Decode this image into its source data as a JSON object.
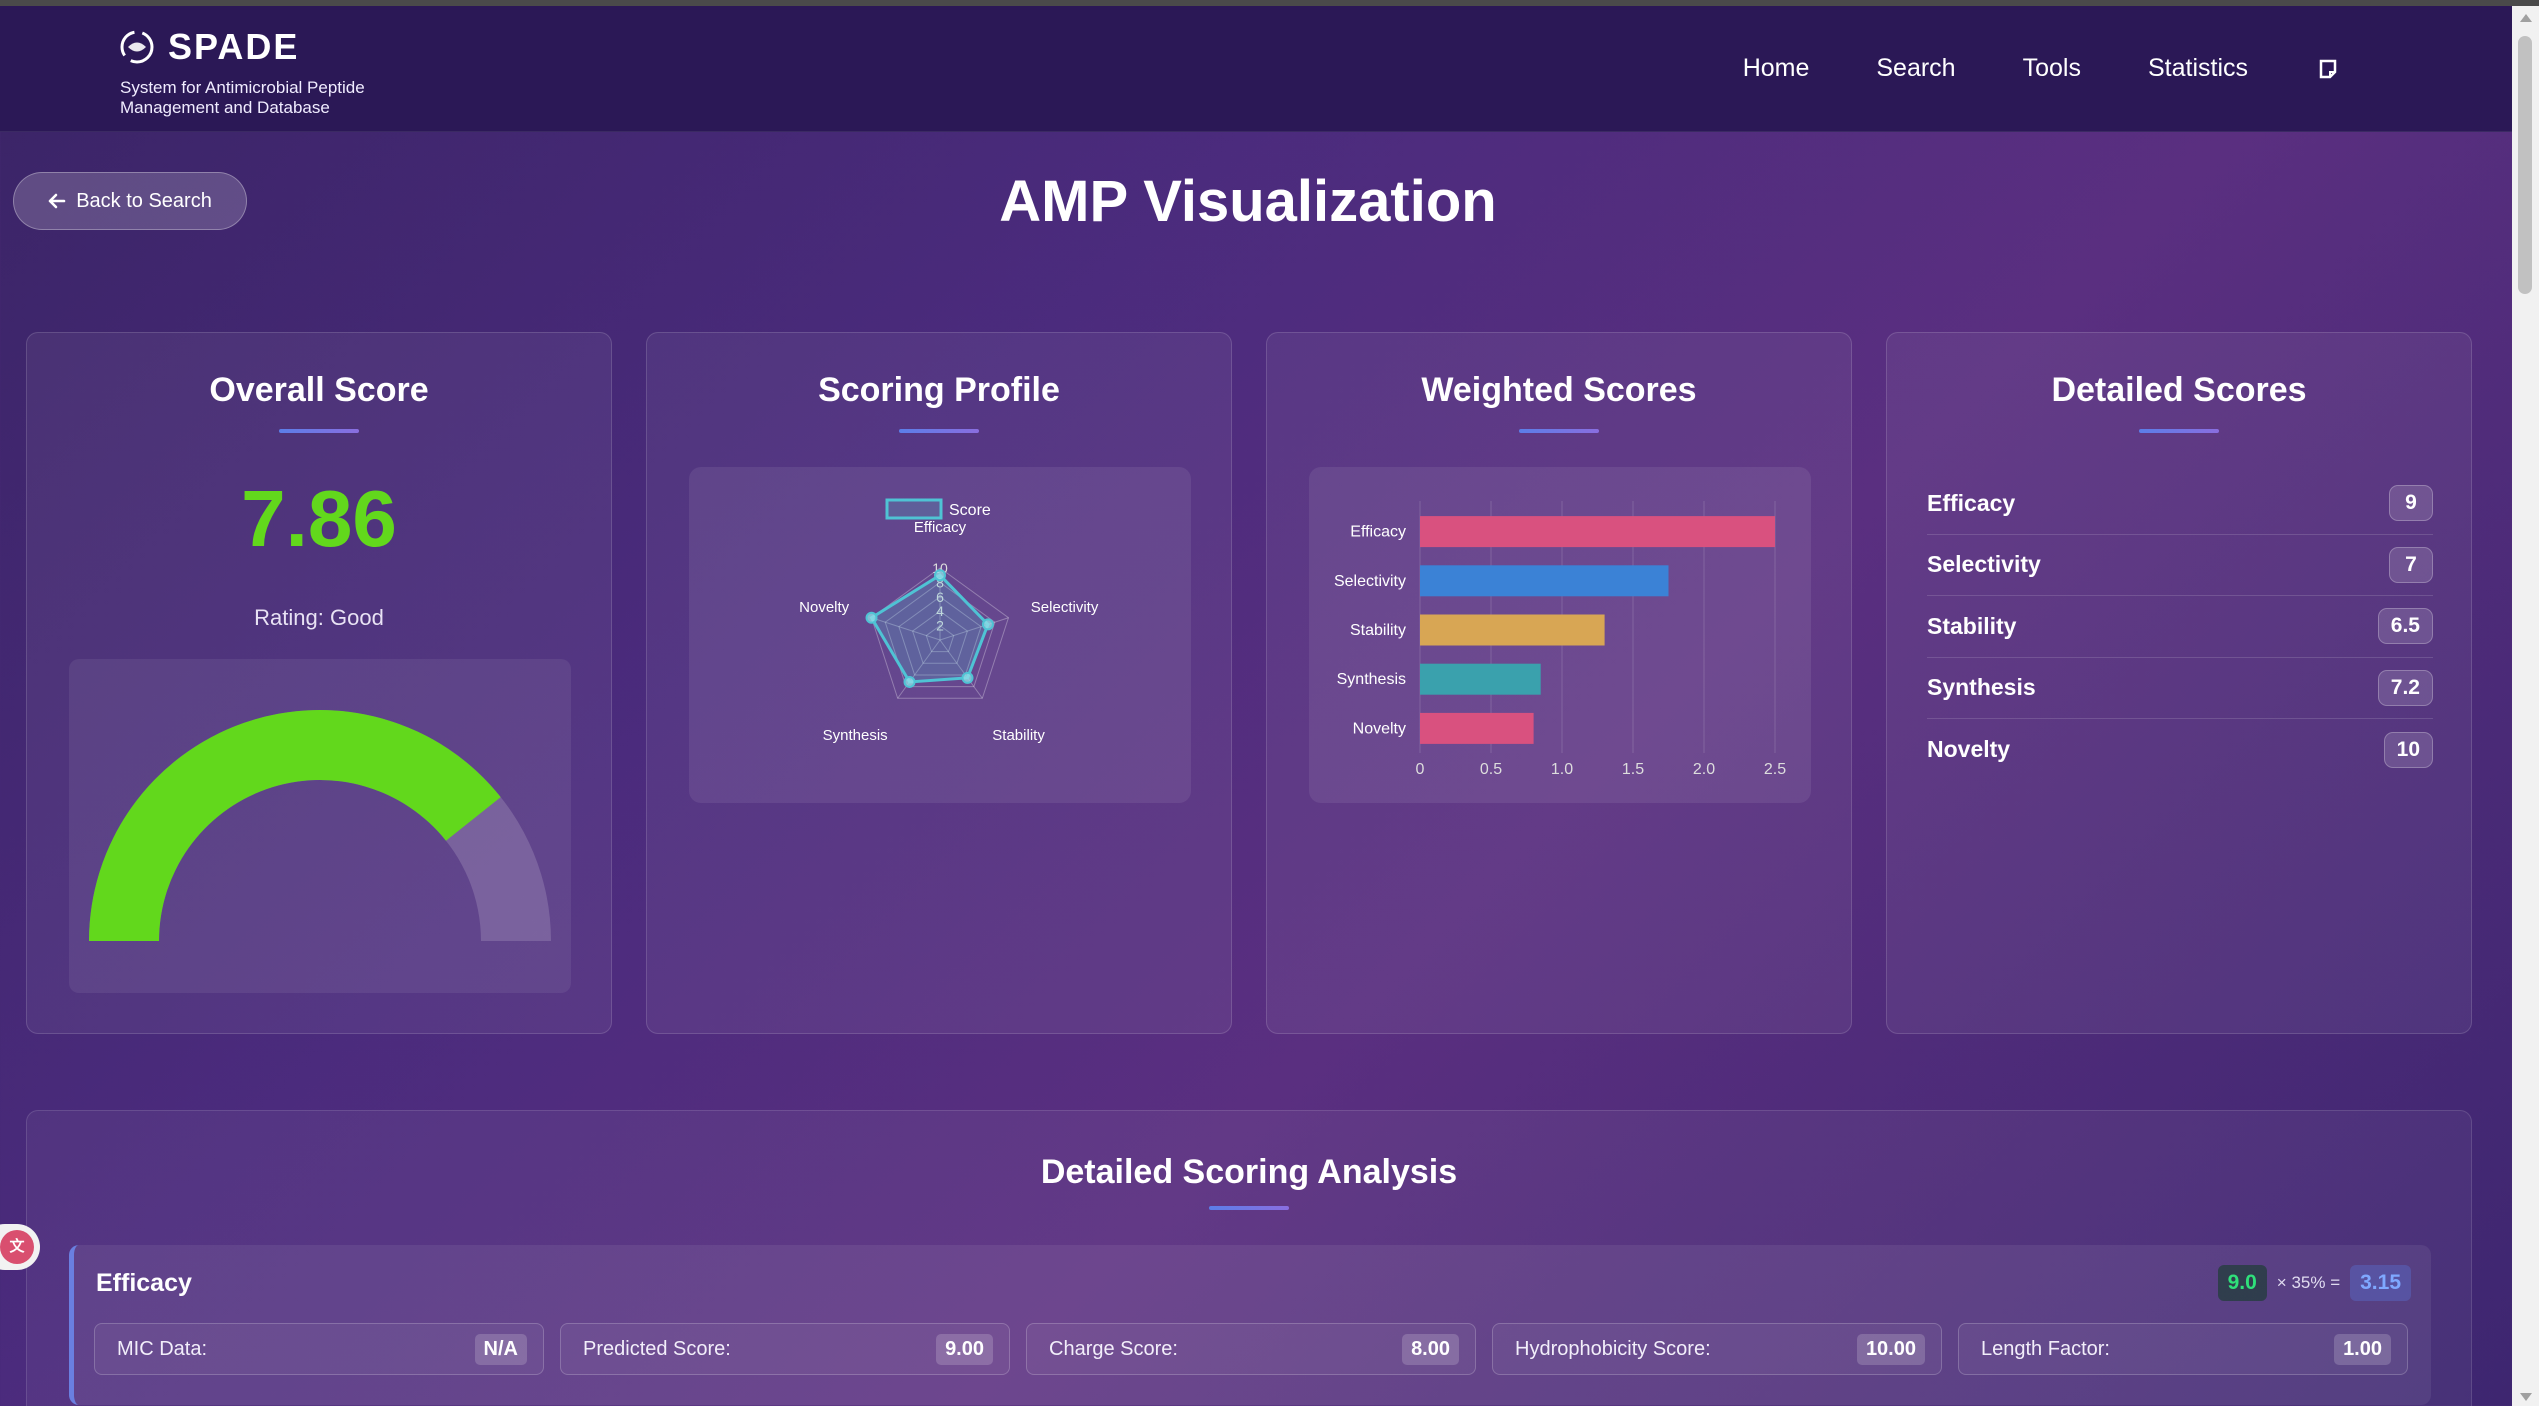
{
  "brand": {
    "title": "SPADE",
    "subtitle": "System for Antimicrobial Peptide Management and Database"
  },
  "nav": {
    "links": [
      "Home",
      "Search",
      "Tools",
      "Statistics"
    ],
    "extra_icon": "note-icon"
  },
  "back_button": "Back to Search",
  "page_title": "AMP Visualization",
  "overall": {
    "title": "Overall Score",
    "score": "7.86",
    "rating": "Rating: Good",
    "gauge_fraction": 0.786,
    "gauge_color": "#62d81c"
  },
  "profile": {
    "title": "Scoring Profile",
    "legend": "Score"
  },
  "weighted": {
    "title": "Weighted Scores"
  },
  "details": {
    "title": "Detailed Scores",
    "items": [
      {
        "label": "Efficacy",
        "value": "9"
      },
      {
        "label": "Selectivity",
        "value": "7"
      },
      {
        "label": "Stability",
        "value": "6.5"
      },
      {
        "label": "Synthesis",
        "value": "7.2"
      },
      {
        "label": "Novelty",
        "value": "10"
      }
    ]
  },
  "analysis": {
    "title": "Detailed Scoring Analysis",
    "criterion": {
      "name": "Efficacy",
      "raw": "9.0",
      "weight_text": "× 35% =",
      "weighted": "3.15",
      "metrics": [
        {
          "label": "MIC Data:",
          "value": "N/A"
        },
        {
          "label": "Predicted Score:",
          "value": "9.00"
        },
        {
          "label": "Charge Score:",
          "value": "8.00"
        },
        {
          "label": "Hydrophobicity Score:",
          "value": "10.00"
        },
        {
          "label": "Length Factor:",
          "value": "1.00"
        }
      ]
    }
  },
  "colors": {
    "accent_green": "#62d81c",
    "radar": "#4fc3d4",
    "bars": [
      "#d9517f",
      "#3b82d6",
      "#d8a654",
      "#3aa1ad",
      "#d9517f"
    ]
  },
  "chart_data": [
    {
      "type": "radar",
      "legend": [
        "Score"
      ],
      "categories": [
        "Efficacy",
        "Selectivity",
        "Stability",
        "Synthesis",
        "Novelty"
      ],
      "series": [
        {
          "name": "Score",
          "values": [
            9,
            7,
            6.5,
            7.2,
            10
          ]
        }
      ],
      "r_ticks": [
        "2",
        "4",
        "6",
        "8",
        "10"
      ],
      "rlim": [
        0,
        10
      ]
    },
    {
      "type": "bar",
      "orientation": "horizontal",
      "categories": [
        "Efficacy",
        "Selectivity",
        "Stability",
        "Synthesis",
        "Novelty"
      ],
      "values": [
        2.5,
        1.75,
        1.3,
        0.85,
        0.8
      ],
      "x_ticks": [
        "0",
        "0.5",
        "1.0",
        "1.5",
        "2.0",
        "2.5"
      ],
      "xlim": [
        0,
        2.5
      ],
      "grid": true
    }
  ]
}
